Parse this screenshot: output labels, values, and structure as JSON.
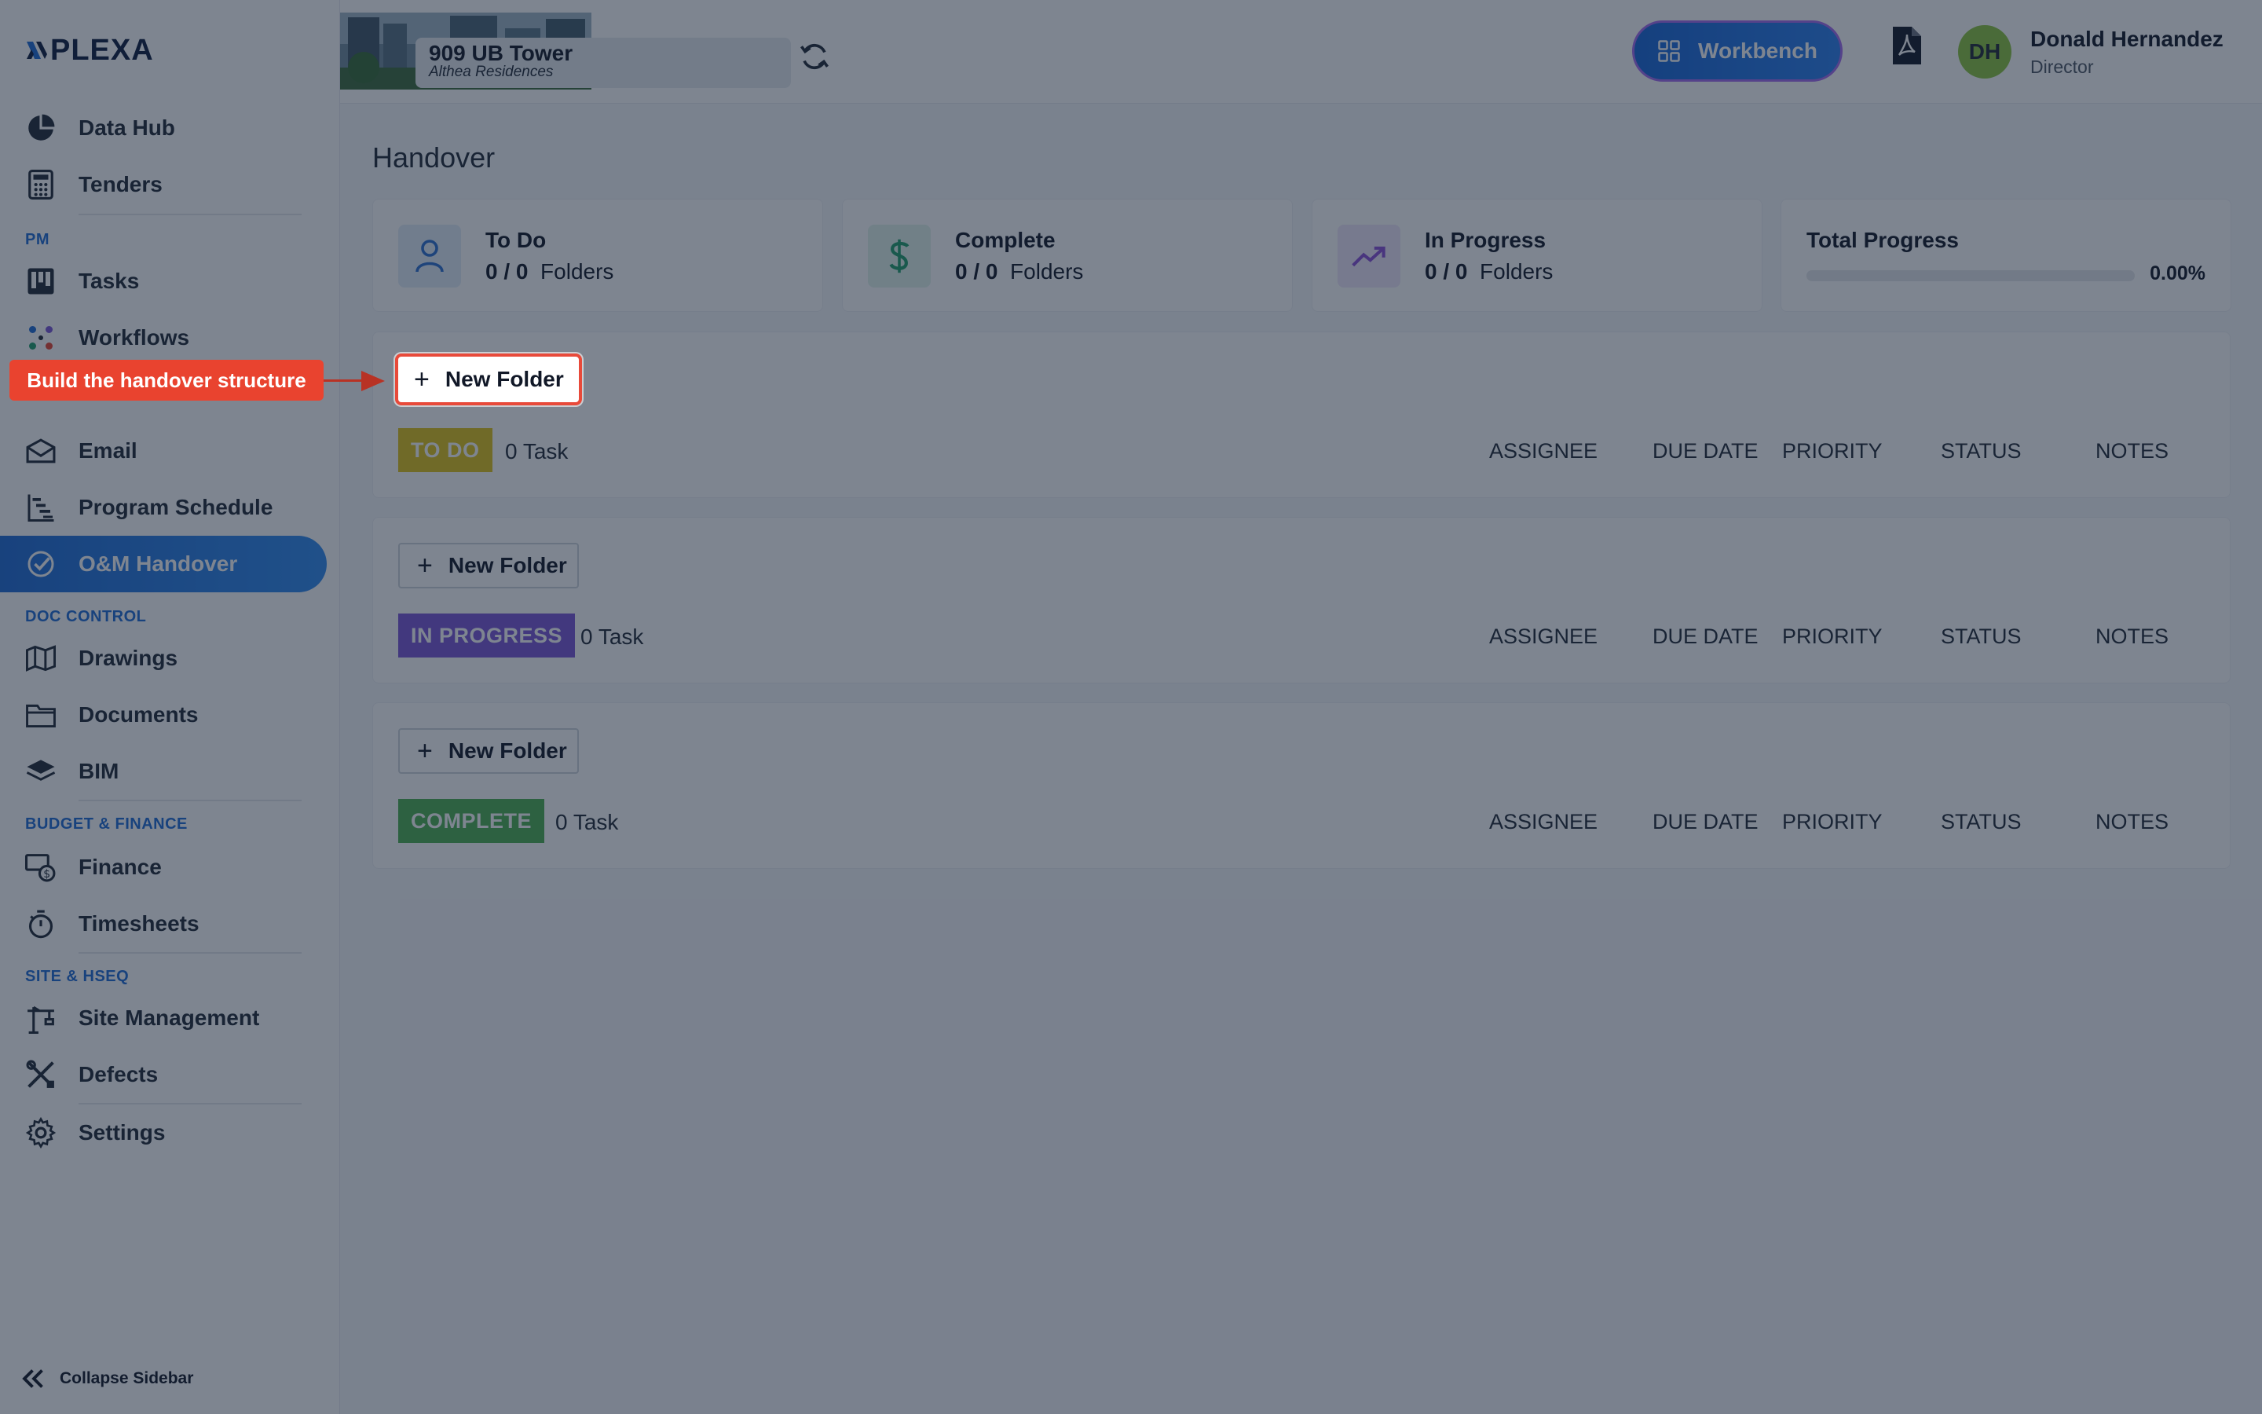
{
  "brand": {
    "logo_text": "PLEXA"
  },
  "sidebar": {
    "items_top": [
      {
        "label": "Data Hub",
        "icon": "pie-chart-icon"
      },
      {
        "label": "Tenders",
        "icon": "calculator-icon"
      }
    ],
    "sections": {
      "pm": "PM",
      "doc_control": "DOC CONTROL",
      "budget_finance": "BUDGET & FINANCE",
      "site_hseq": "SITE & HSEQ"
    },
    "items_pm": [
      {
        "label": "Tasks",
        "icon": "kanban-icon"
      },
      {
        "label": "Workflows",
        "icon": "workflow-icon"
      },
      {
        "label": "Email",
        "icon": "mail-icon"
      },
      {
        "label": "Program Schedule",
        "icon": "gantt-icon"
      },
      {
        "label": "O&M Handover",
        "icon": "check-circle-icon",
        "active": true
      }
    ],
    "items_doc": [
      {
        "label": "Drawings",
        "icon": "map-icon"
      },
      {
        "label": "Documents",
        "icon": "folder-icon"
      },
      {
        "label": "BIM",
        "icon": "layers-icon"
      }
    ],
    "items_budget": [
      {
        "label": "Finance",
        "icon": "money-icon"
      },
      {
        "label": "Timesheets",
        "icon": "stopwatch-icon"
      }
    ],
    "items_site": [
      {
        "label": "Site Management",
        "icon": "crane-icon"
      },
      {
        "label": "Defects",
        "icon": "tools-icon"
      },
      {
        "label": "Settings",
        "icon": "gear-icon"
      }
    ],
    "collapse_label": "Collapse Sidebar"
  },
  "header": {
    "project_name": "909 UB Tower",
    "project_sub": "Althea Residences",
    "workbench_label": "Workbench",
    "user_initials": "DH",
    "user_name": "Donald Hernandez",
    "user_role": "Director"
  },
  "page": {
    "title": "Handover",
    "stats": [
      {
        "title": "To Do",
        "count": "0 / 0",
        "unit": "Folders",
        "icon": "user-icon",
        "icon_bg": "#e3edf9",
        "icon_color": "#2c6fd1"
      },
      {
        "title": "Complete",
        "count": "0 / 0",
        "unit": "Folders",
        "icon": "dollar-icon",
        "icon_bg": "#e2f4ec",
        "icon_color": "#1f9d6b"
      },
      {
        "title": "In Progress",
        "count": "0 / 0",
        "unit": "Folders",
        "icon": "trending-up-icon",
        "icon_bg": "#efe7fa",
        "icon_color": "#8a4fd8"
      }
    ],
    "total_progress": {
      "title": "Total Progress",
      "value_text": "0.00%",
      "fraction": 0
    },
    "new_folder_label": "New Folder",
    "columns": [
      "ASSIGNEE",
      "DUE DATE",
      "PRIORITY",
      "STATUS",
      "NOTES"
    ],
    "groups": [
      {
        "status": "TO DO",
        "color": "#e0c419",
        "tasks": "0 Task"
      },
      {
        "status": "IN PROGRESS",
        "color": "#7a56d8",
        "tasks": "0 Task"
      },
      {
        "status": "COMPLETE",
        "color": "#4caf50",
        "tasks": "0 Task"
      }
    ]
  },
  "tour": {
    "callout_text": "Build the handover structure",
    "target_label": "New Folder",
    "accent": "#e9432f"
  }
}
